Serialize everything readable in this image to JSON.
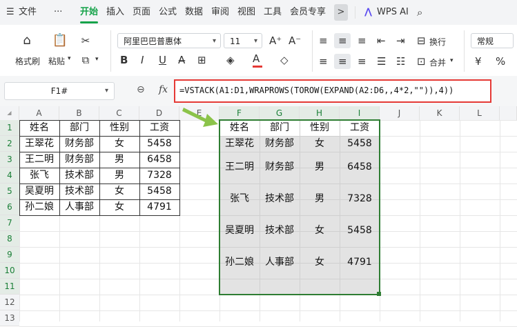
{
  "menubar": {
    "file_label": "文件",
    "tabs": [
      "开始",
      "插入",
      "页面",
      "公式",
      "数据",
      "审阅",
      "视图",
      "工具",
      "会员专享"
    ],
    "active_tab": "开始",
    "ai_label": "WPS AI",
    "more_glyph": ">"
  },
  "ribbon": {
    "format_painter": "格式刷",
    "paste": "粘贴",
    "font_name": "阿里巴巴普惠体",
    "font_size": "11",
    "wrap_text": "换行",
    "merge": "合并",
    "number_format": "常规",
    "bold": "B",
    "italic": "I",
    "underline": "U",
    "fx": "fx"
  },
  "formula_bar": {
    "cell_ref": "F1#",
    "formula": "=VSTACK(A1:D1,WRAPROWS(TOROW(EXPAND(A2:D6,,4*2,\"\")),4))"
  },
  "sheet": {
    "columns": [
      "A",
      "B",
      "C",
      "D",
      "E",
      "F",
      "G",
      "H",
      "I",
      "J",
      "K",
      "L"
    ],
    "rows": [
      "1",
      "2",
      "3",
      "4",
      "5",
      "6",
      "7",
      "8",
      "9",
      "10",
      "11",
      "12",
      "13"
    ],
    "source_table": [
      [
        "姓名",
        "部门",
        "性别",
        "工资"
      ],
      [
        "王翠花",
        "财务部",
        "女",
        "5458"
      ],
      [
        "王二明",
        "财务部",
        "男",
        "6458"
      ],
      [
        "张飞",
        "技术部",
        "男",
        "7328"
      ],
      [
        "吴夏明",
        "技术部",
        "女",
        "5458"
      ],
      [
        "孙二娘",
        "人事部",
        "女",
        "4791"
      ]
    ],
    "result_header": [
      "姓名",
      "部门",
      "性别",
      "工资"
    ],
    "result_rows": [
      [
        "王翠花",
        "财务部",
        "女",
        "5458"
      ],
      [
        "王二明",
        "财务部",
        "男",
        "6458"
      ],
      [
        "张飞",
        "技术部",
        "男",
        "7328"
      ],
      [
        "吴夏明",
        "技术部",
        "女",
        "5458"
      ],
      [
        "孙二娘",
        "人事部",
        "女",
        "4791"
      ]
    ]
  },
  "colors": {
    "accent_green": "#16a34a",
    "selection_border": "#2e7d32",
    "formula_highlight": "#e53935",
    "arrow": "#8bc34a"
  }
}
